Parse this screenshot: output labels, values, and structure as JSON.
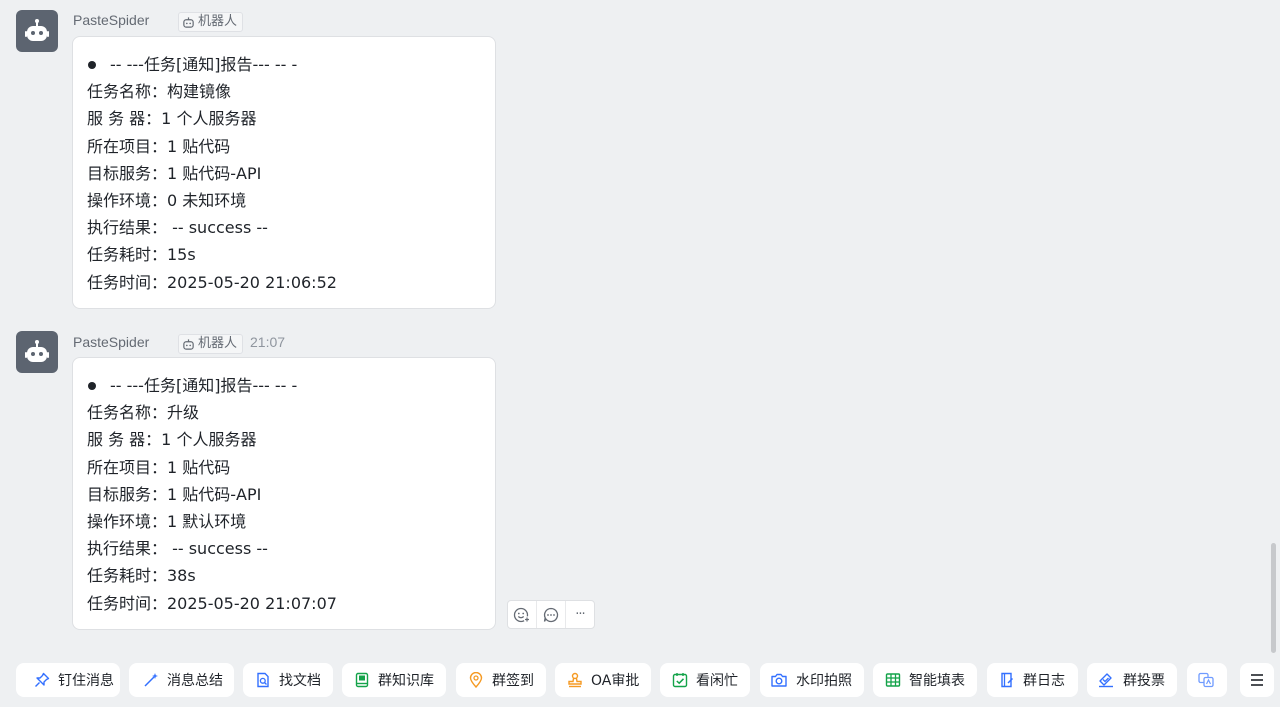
{
  "messages": [
    {
      "sender": "PasteSpider",
      "tag": "机器人",
      "time": "",
      "lines": [
        "-- ---任务[通知]报告--- -- -",
        "任务名称：构建镜像",
        "服  务  器：1 个人服务器",
        "所在项目：1 贴代码",
        "目标服务：1 贴代码-API",
        "操作环境：0 未知环境",
        "执行结果：  -- success --",
        "任务耗时：15s",
        "任务时间：2025-05-20 21:06:52"
      ]
    },
    {
      "sender": "PasteSpider",
      "tag": "机器人",
      "time": "21:07",
      "lines": [
        "-- ---任务[通知]报告--- -- -",
        "任务名称：升级",
        "服  务  器：1 个人服务器",
        "所在项目：1 贴代码",
        "目标服务：1 贴代码-API",
        "操作环境：1 默认环境",
        "执行结果：  -- success --",
        "任务耗时：38s",
        "任务时间：2025-05-20 21:07:07"
      ]
    }
  ],
  "reactions": {
    "icons": [
      "emoji-add-icon",
      "reply-icon",
      "more-icon"
    ],
    "more_label": "···"
  },
  "toolbar": [
    {
      "label": "钉住消息",
      "icon": "pin-icon",
      "color": "#3370ff"
    },
    {
      "label": "消息总结",
      "icon": "sparkle-icon",
      "color": "#3370ff"
    },
    {
      "label": "找文档",
      "icon": "doc-search-icon",
      "color": "#3370ff"
    },
    {
      "label": "群知识库",
      "icon": "knowledge-base-icon",
      "color": "#14a34a"
    },
    {
      "label": "群签到",
      "icon": "location-checkin-icon",
      "color": "#f59a23"
    },
    {
      "label": "OA审批",
      "icon": "stamp-icon",
      "color": "#f59a23"
    },
    {
      "label": "看闲忙",
      "icon": "calendar-check-icon",
      "color": "#14a34a"
    },
    {
      "label": "水印拍照",
      "icon": "camera-icon",
      "color": "#3370ff"
    },
    {
      "label": "智能填表",
      "icon": "table-icon",
      "color": "#14a34a"
    },
    {
      "label": "群日志",
      "icon": "log-icon",
      "color": "#3370ff"
    },
    {
      "label": "群投票",
      "icon": "vote-icon",
      "color": "#3370ff"
    },
    {
      "label": "",
      "icon": "translate-icon",
      "color": "#3370ff"
    }
  ],
  "menu": {
    "icon": "hamburger-menu-icon"
  }
}
